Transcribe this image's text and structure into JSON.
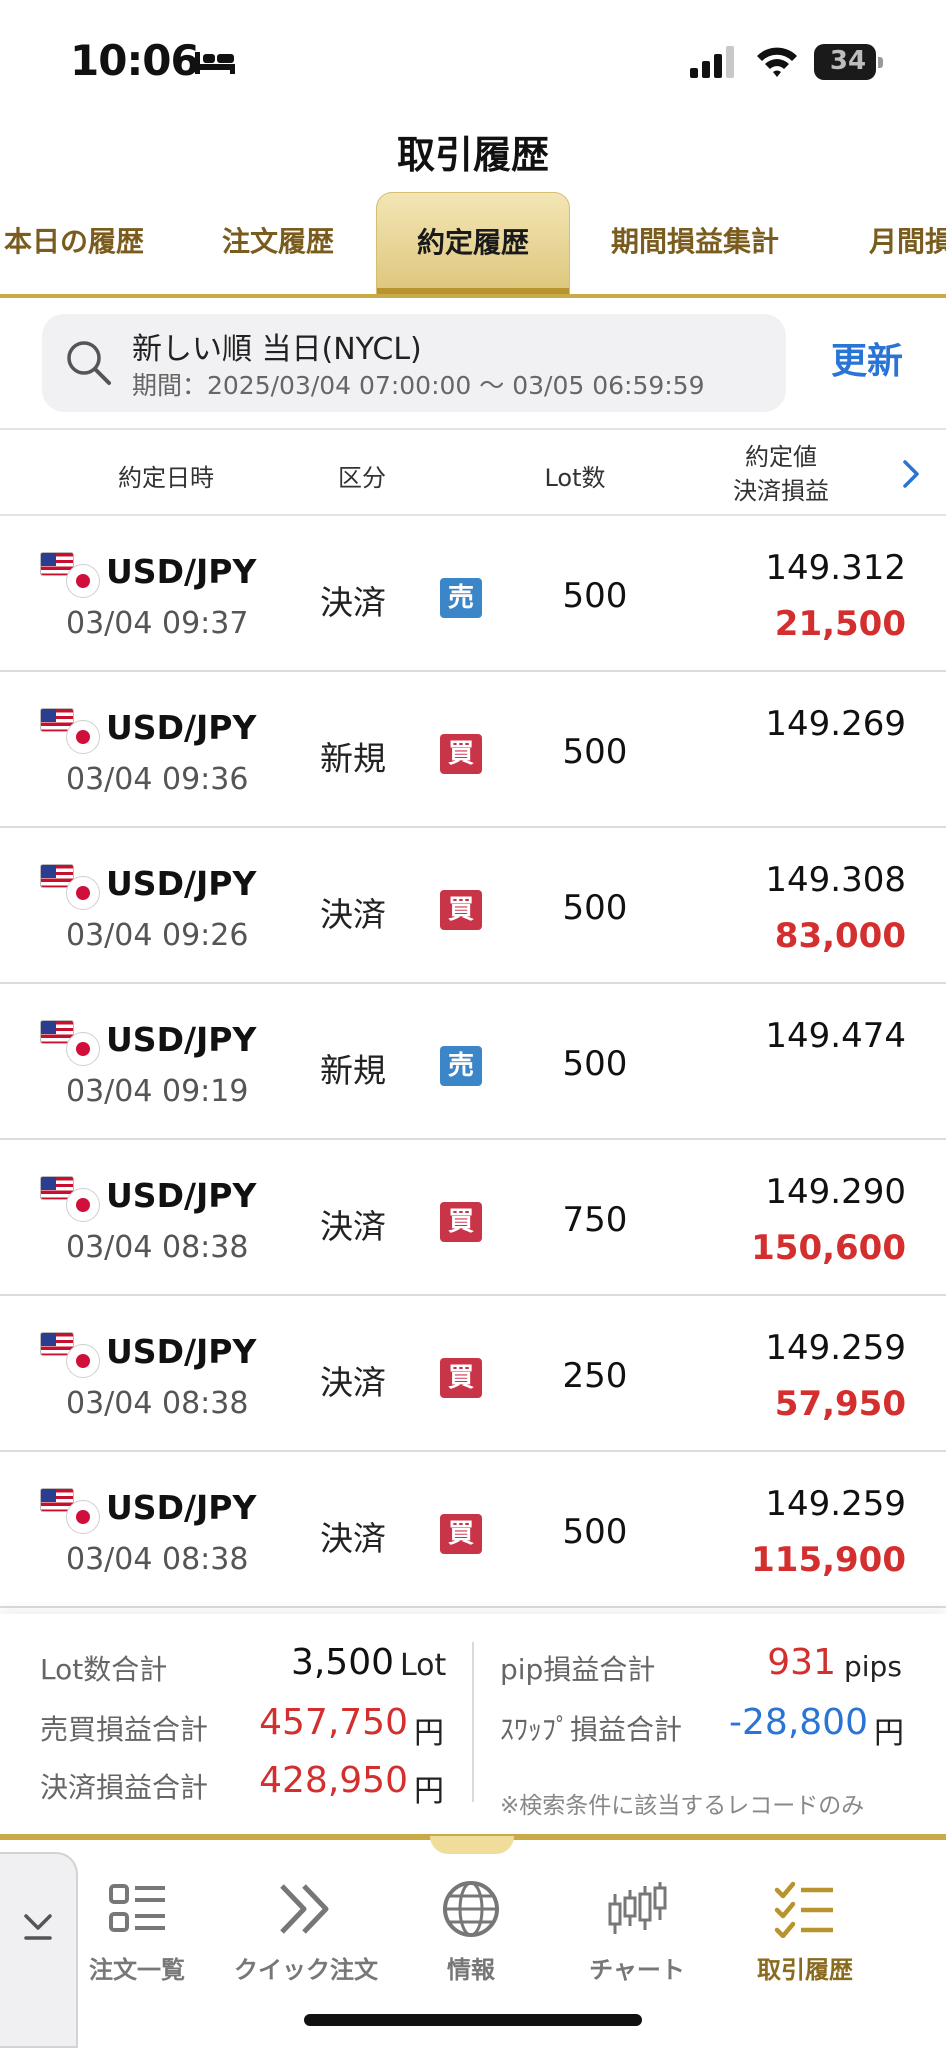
{
  "status_bar": {
    "time": "10:06",
    "battery": "34"
  },
  "header": {
    "title": "取引履歴"
  },
  "tabs": [
    {
      "label": "本日の履歴",
      "active": false
    },
    {
      "label": "注文履歴",
      "active": false
    },
    {
      "label": "約定履歴",
      "active": true
    },
    {
      "label": "期間損益集計",
      "active": false
    },
    {
      "label": "月間損",
      "active": false
    }
  ],
  "search": {
    "line1": "新しい順 当日(NYCL)",
    "line2": "期間：2025/03/04 07:00:00 ～ 03/05 06:59:59",
    "refresh_label": "更新"
  },
  "table": {
    "headers": {
      "datetime": "約定日時",
      "kind": "区分",
      "lot": "Lot数",
      "price": "約定値",
      "pnl": "決済損益"
    },
    "rows": [
      {
        "pair": "USD/JPY",
        "datetime": "03/04 09:37",
        "kind": "決済",
        "side": "売",
        "side_type": "sell",
        "lot": "500",
        "price": "149.312",
        "pnl": "21,500"
      },
      {
        "pair": "USD/JPY",
        "datetime": "03/04 09:36",
        "kind": "新規",
        "side": "買",
        "side_type": "buy",
        "lot": "500",
        "price": "149.269",
        "pnl": ""
      },
      {
        "pair": "USD/JPY",
        "datetime": "03/04 09:26",
        "kind": "決済",
        "side": "買",
        "side_type": "buy",
        "lot": "500",
        "price": "149.308",
        "pnl": "83,000"
      },
      {
        "pair": "USD/JPY",
        "datetime": "03/04 09:19",
        "kind": "新規",
        "side": "売",
        "side_type": "sell",
        "lot": "500",
        "price": "149.474",
        "pnl": ""
      },
      {
        "pair": "USD/JPY",
        "datetime": "03/04 08:38",
        "kind": "決済",
        "side": "買",
        "side_type": "buy",
        "lot": "750",
        "price": "149.290",
        "pnl": "150,600"
      },
      {
        "pair": "USD/JPY",
        "datetime": "03/04 08:38",
        "kind": "決済",
        "side": "買",
        "side_type": "buy",
        "lot": "250",
        "price": "149.259",
        "pnl": "57,950"
      },
      {
        "pair": "USD/JPY",
        "datetime": "03/04 08:38",
        "kind": "決済",
        "side": "買",
        "side_type": "buy",
        "lot": "500",
        "price": "149.259",
        "pnl": "115,900"
      }
    ]
  },
  "summary": {
    "lot_total_label": "Lot数合計",
    "lot_total_value": "3,500",
    "lot_total_unit": "Lot",
    "trade_pnl_label": "売買損益合計",
    "trade_pnl_value": "457,750",
    "settle_pnl_label": "決済損益合計",
    "settle_pnl_value": "428,950",
    "yen_unit": "円",
    "pip_label": "pip損益合計",
    "pip_value": "931",
    "pip_unit": "pips",
    "swap_label": "ｽﾜｯﾌﾟ損益合計",
    "swap_value": "-28,800",
    "note": "※検索条件に該当するレコードのみ"
  },
  "colors": {
    "accent_gold": "#c9a948",
    "profit_red": "#d32f2f",
    "loss_blue": "#2a74d6",
    "sell_blue": "#3b86c8",
    "buy_red": "#c93449"
  },
  "bottom_nav": [
    {
      "label": "注文一覧",
      "icon": "list-icon",
      "active": false
    },
    {
      "label": "クイック注文",
      "icon": "double-chevron-icon",
      "active": false
    },
    {
      "label": "情報",
      "icon": "globe-icon",
      "active": false
    },
    {
      "label": "チャート",
      "icon": "candlestick-chart-icon",
      "active": false
    },
    {
      "label": "取引履歴",
      "icon": "checklist-icon",
      "active": true
    }
  ]
}
